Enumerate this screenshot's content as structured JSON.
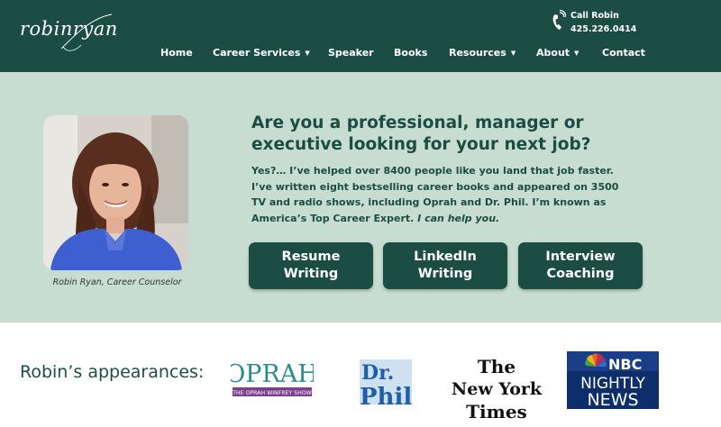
{
  "header": {
    "logo_text": "robinryan",
    "call_label": "Call Robin",
    "call_number": "425.226.0414",
    "nav": [
      {
        "label": "Home",
        "has_dropdown": false
      },
      {
        "label": "Career Services",
        "has_dropdown": true
      },
      {
        "label": "Speaker",
        "has_dropdown": false
      },
      {
        "label": "Books",
        "has_dropdown": false
      },
      {
        "label": "Resources",
        "has_dropdown": true
      },
      {
        "label": "About",
        "has_dropdown": true
      },
      {
        "label": "Contact",
        "has_dropdown": false
      }
    ]
  },
  "hero": {
    "photo_caption": "Robin Ryan, Career Counselor",
    "headline_line1": "Are you a professional, manager or",
    "headline_line2": "executive looking for your next job?",
    "body_line1": "Yes?… I’ve helped over 8400 people like you land that job faster.",
    "body_line2": "I’ve written eight bestselling career books and appeared on 3500",
    "body_line3": "TV and radio shows, including Oprah and Dr. Phil.  I’m known as",
    "body_line4_plain": "America’s Top Career Expert. ",
    "body_line4_italic": "I can help you.",
    "buttons": [
      {
        "line1": "Resume",
        "line2": "Writing"
      },
      {
        "line1": "LinkedIn",
        "line2": "Writing"
      },
      {
        "line1": "Interview",
        "line2": "Coaching"
      }
    ]
  },
  "appearances": {
    "label": "Robin’s appearances:",
    "oprah": {
      "title": "OPRAH",
      "subtitle": "THE OPRAH WINFREY SHOW"
    },
    "drphil": {
      "line1": "Dr.",
      "line2": "Phil"
    },
    "nyt": {
      "line1": "The",
      "line2": "New York",
      "line3": "Times"
    },
    "nbc": {
      "brand": "NBC",
      "line1": "NIGHTLY",
      "line2": "NEWS"
    }
  },
  "colors": {
    "header_bg": "#1b4d43",
    "hero_bg": "#c8ddd1",
    "accent_text": "#1b4d43",
    "button_bg": "#1b4d43",
    "oprah_purple": "#7b3f8c",
    "drphil_blue": "#1f5fa8",
    "nbc_navy": "#0e2e6b"
  }
}
